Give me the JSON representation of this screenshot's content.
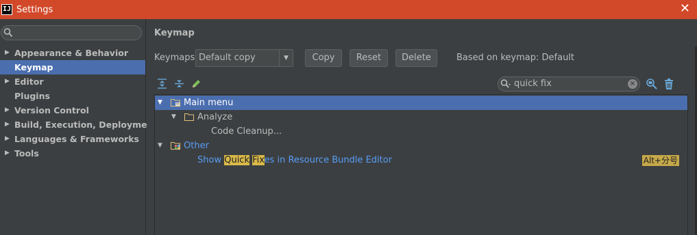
{
  "titlebar": {
    "app_icon_text": "IJ",
    "title": "Settings",
    "close_glyph": "✕"
  },
  "sidebar": {
    "search": {
      "value": "",
      "icon": "search-icon"
    },
    "items": [
      {
        "label": "Appearance & Behavior",
        "expandable": true,
        "selected": false
      },
      {
        "label": "Keymap",
        "expandable": false,
        "selected": true
      },
      {
        "label": "Editor",
        "expandable": true,
        "selected": false
      },
      {
        "label": "Plugins",
        "expandable": false,
        "selected": false
      },
      {
        "label": "Version Control",
        "expandable": true,
        "selected": false
      },
      {
        "label": "Build, Execution, Deployment",
        "expandable": true,
        "selected": false
      },
      {
        "label": "Languages & Frameworks",
        "expandable": true,
        "selected": false
      },
      {
        "label": "Tools",
        "expandable": true,
        "selected": false
      }
    ]
  },
  "main": {
    "heading": "Keymap",
    "keymaps_label": "Keymaps:",
    "keymap_selected": "Default copy",
    "buttons": {
      "copy": "Copy",
      "reset": "Reset",
      "delete": "Delete"
    },
    "based_on": "Based on keymap: Default",
    "toolbar_icons": [
      "expand-all-icon",
      "collapse-all-icon",
      "edit-icon"
    ],
    "filter": {
      "value": "quick fix",
      "icon": "search-icon"
    },
    "tree": {
      "main_menu": "Main menu",
      "analyze": "Analyze",
      "code_cleanup": "Code Cleanup...",
      "other": "Other",
      "action": {
        "pre": "Show ",
        "hl1": "Quick",
        "mid": " ",
        "hl2": "Fix",
        "post": "es in Resource Bundle Editor"
      },
      "shortcut": "Alt+分号"
    }
  },
  "colors": {
    "titlebar": "#d2492a",
    "selection": "#4b6eaf",
    "background": "#3c3f41",
    "link": "#589df6",
    "highlight": "#d8b84a"
  }
}
